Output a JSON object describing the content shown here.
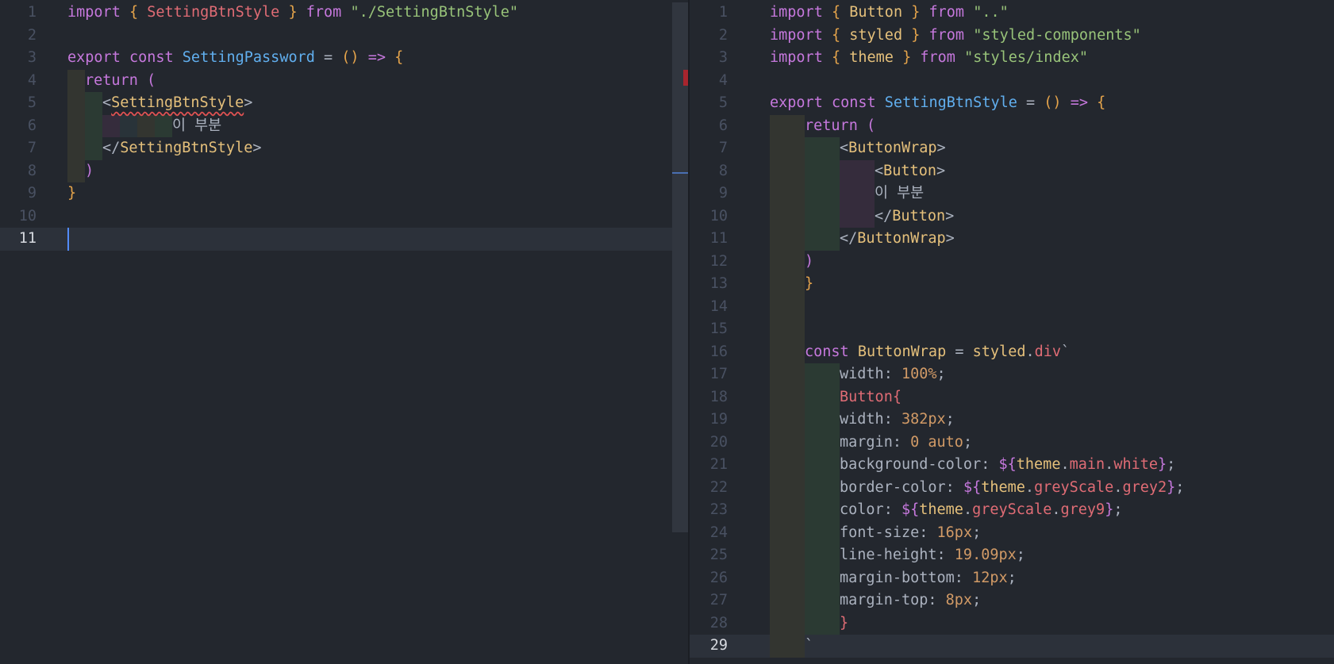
{
  "left": {
    "active_line": 11,
    "lines": [
      {
        "n": "1",
        "t": [
          [
            "kw",
            "import "
          ],
          [
            "br",
            "{ "
          ],
          [
            "var",
            "SettingBtnStyle"
          ],
          [
            "br",
            " }"
          ],
          [
            "kw",
            " from "
          ],
          [
            "str",
            "\"./SettingBtnStyle\""
          ]
        ]
      },
      {
        "n": "2",
        "t": []
      },
      {
        "n": "3",
        "t": [
          [
            "kw",
            "export const "
          ],
          [
            "fn",
            "SettingPassword"
          ],
          [
            "pl",
            " = "
          ],
          [
            "br",
            "()"
          ],
          [
            "kw",
            " => "
          ],
          [
            "br",
            "{"
          ]
        ]
      },
      {
        "n": "4",
        "t": [
          [
            "kw",
            "return "
          ],
          [
            "br2",
            "("
          ]
        ]
      },
      {
        "n": "5",
        "t": [
          [
            "pl",
            "<"
          ],
          [
            "tag-err",
            "SettingBtnStyle"
          ],
          [
            "pl",
            ">"
          ]
        ]
      },
      {
        "n": "6",
        "t": [
          [
            "pl",
            "이 부분"
          ]
        ]
      },
      {
        "n": "7",
        "t": [
          [
            "pl",
            "</"
          ],
          [
            "tag",
            "SettingBtnStyle"
          ],
          [
            "pl",
            ">"
          ]
        ]
      },
      {
        "n": "8",
        "t": [
          [
            "br2",
            ")"
          ]
        ]
      },
      {
        "n": "9",
        "t": [
          [
            "br",
            "}"
          ]
        ]
      },
      {
        "n": "10",
        "t": []
      },
      {
        "n": "11",
        "t": []
      }
    ]
  },
  "right": {
    "active_line": 29,
    "lines": [
      {
        "n": "1",
        "t": [
          [
            "kw",
            "import "
          ],
          [
            "br",
            "{ "
          ],
          [
            "tag",
            "Button"
          ],
          [
            "br",
            " }"
          ],
          [
            "kw",
            " from "
          ],
          [
            "str",
            "\"..\""
          ]
        ]
      },
      {
        "n": "2",
        "t": [
          [
            "kw",
            "import "
          ],
          [
            "br",
            "{ "
          ],
          [
            "tag",
            "styled"
          ],
          [
            "br",
            " }"
          ],
          [
            "kw",
            " from "
          ],
          [
            "str",
            "\"styled-components\""
          ]
        ]
      },
      {
        "n": "3",
        "t": [
          [
            "kw",
            "import "
          ],
          [
            "br",
            "{ "
          ],
          [
            "tag",
            "theme"
          ],
          [
            "br",
            " }"
          ],
          [
            "kw",
            " from "
          ],
          [
            "str",
            "\"styles/index\""
          ]
        ]
      },
      {
        "n": "4",
        "t": []
      },
      {
        "n": "5",
        "t": [
          [
            "kw",
            "export const "
          ],
          [
            "fn",
            "SettingBtnStyle"
          ],
          [
            "pl",
            " = "
          ],
          [
            "br",
            "()"
          ],
          [
            "kw",
            " => "
          ],
          [
            "br",
            "{"
          ]
        ]
      },
      {
        "n": "6",
        "t": [
          [
            "kw",
            "return "
          ],
          [
            "br2",
            "("
          ]
        ]
      },
      {
        "n": "7",
        "t": [
          [
            "pl",
            "<"
          ],
          [
            "tag",
            "ButtonWrap"
          ],
          [
            "pl",
            ">"
          ]
        ]
      },
      {
        "n": "8",
        "t": [
          [
            "pl",
            "<"
          ],
          [
            "tag",
            "Button"
          ],
          [
            "pl",
            ">"
          ]
        ]
      },
      {
        "n": "9",
        "t": [
          [
            "pl",
            "이 부분"
          ]
        ]
      },
      {
        "n": "10",
        "t": [
          [
            "pl",
            "</"
          ],
          [
            "tag",
            "Button"
          ],
          [
            "pl",
            ">"
          ]
        ]
      },
      {
        "n": "11",
        "t": [
          [
            "pl",
            "</"
          ],
          [
            "tag",
            "ButtonWrap"
          ],
          [
            "pl",
            ">"
          ]
        ]
      },
      {
        "n": "12",
        "t": [
          [
            "br2",
            ")"
          ]
        ]
      },
      {
        "n": "13",
        "t": [
          [
            "br",
            "}"
          ]
        ]
      },
      {
        "n": "14",
        "t": []
      },
      {
        "n": "15",
        "t": []
      },
      {
        "n": "16",
        "t": [
          [
            "kw",
            "const "
          ],
          [
            "tag",
            "ButtonWrap"
          ],
          [
            "pl",
            " = "
          ],
          [
            "tag",
            "styled"
          ],
          [
            "pl",
            "."
          ],
          [
            "var",
            "div"
          ],
          [
            "pl",
            "`"
          ]
        ]
      },
      {
        "n": "17",
        "t": [
          [
            "pl",
            "width: "
          ],
          [
            "num",
            "100%"
          ],
          [
            "pl",
            ";"
          ]
        ]
      },
      {
        "n": "18",
        "t": [
          [
            "var",
            "Button{"
          ]
        ]
      },
      {
        "n": "19",
        "t": [
          [
            "pl",
            "width: "
          ],
          [
            "num",
            "382px"
          ],
          [
            "pl",
            ";"
          ]
        ]
      },
      {
        "n": "20",
        "t": [
          [
            "pl",
            "margin: "
          ],
          [
            "num",
            "0"
          ],
          [
            "pl",
            " "
          ],
          [
            "num",
            "auto"
          ],
          [
            "pl",
            ";"
          ]
        ]
      },
      {
        "n": "21",
        "t": [
          [
            "pl",
            "background-color: "
          ],
          [
            "kw",
            "${"
          ],
          [
            "tag",
            "theme"
          ],
          [
            "pl",
            "."
          ],
          [
            "var",
            "main"
          ],
          [
            "pl",
            "."
          ],
          [
            "var",
            "white"
          ],
          [
            "kw",
            "}"
          ],
          [
            "pl",
            ";"
          ]
        ]
      },
      {
        "n": "22",
        "t": [
          [
            "pl",
            "border-color: "
          ],
          [
            "kw",
            "${"
          ],
          [
            "tag",
            "theme"
          ],
          [
            "pl",
            "."
          ],
          [
            "var",
            "greyScale"
          ],
          [
            "pl",
            "."
          ],
          [
            "var",
            "grey2"
          ],
          [
            "kw",
            "}"
          ],
          [
            "pl",
            ";"
          ]
        ]
      },
      {
        "n": "23",
        "t": [
          [
            "pl",
            "color: "
          ],
          [
            "kw",
            "${"
          ],
          [
            "tag",
            "theme"
          ],
          [
            "pl",
            "."
          ],
          [
            "var",
            "greyScale"
          ],
          [
            "pl",
            "."
          ],
          [
            "var",
            "grey9"
          ],
          [
            "kw",
            "}"
          ],
          [
            "pl",
            ";"
          ]
        ]
      },
      {
        "n": "24",
        "t": [
          [
            "pl",
            "font-size: "
          ],
          [
            "num",
            "16px"
          ],
          [
            "pl",
            ";"
          ]
        ]
      },
      {
        "n": "25",
        "t": [
          [
            "pl",
            "line-height: "
          ],
          [
            "num",
            "19.09px"
          ],
          [
            "pl",
            ";"
          ]
        ]
      },
      {
        "n": "26",
        "t": [
          [
            "pl",
            "margin-bottom: "
          ],
          [
            "num",
            "12px"
          ],
          [
            "pl",
            ";"
          ]
        ]
      },
      {
        "n": "27",
        "t": [
          [
            "pl",
            "margin-top: "
          ],
          [
            "num",
            "8px"
          ],
          [
            "pl",
            ";"
          ]
        ]
      },
      {
        "n": "28",
        "t": [
          [
            "var",
            "}"
          ]
        ]
      },
      {
        "n": "29",
        "t": [
          [
            "pl",
            "`"
          ]
        ]
      }
    ]
  }
}
